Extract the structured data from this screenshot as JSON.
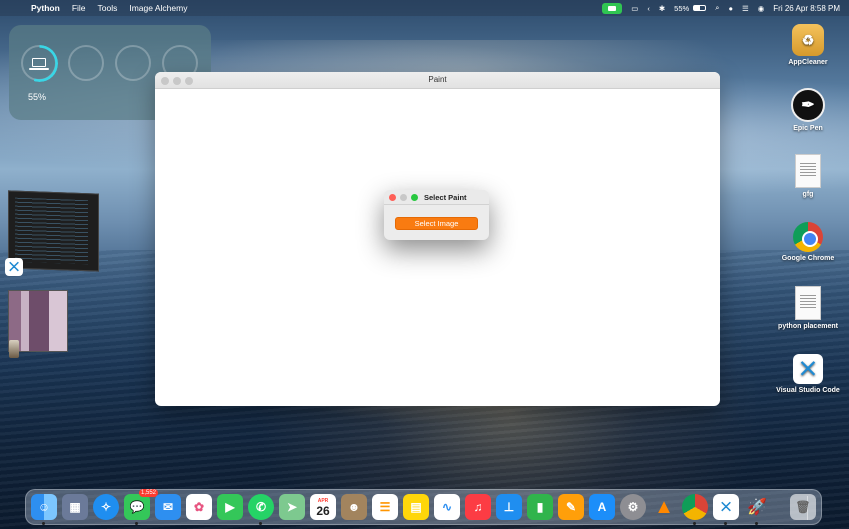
{
  "menubar": {
    "app_name": "Python",
    "menus": [
      "File",
      "Tools",
      "Image Alchemy"
    ],
    "battery_percent": "55%",
    "datetime": "Fri 26 Apr  8:58 PM"
  },
  "widget": {
    "battery_label": "55%",
    "battery_level": 0.55
  },
  "desktop_icons": [
    {
      "label": "AppCleaner",
      "icon": "appcleaner-icon"
    },
    {
      "label": "Epic Pen",
      "icon": "epic-pen-icon"
    },
    {
      "label": "gfg",
      "icon": "document-icon"
    },
    {
      "label": "Google Chrome",
      "icon": "chrome-icon"
    },
    {
      "label": "python placement",
      "icon": "document-icon"
    },
    {
      "label": "Visual Studio Code",
      "icon": "vscode-icon"
    }
  ],
  "window": {
    "title": "Paint"
  },
  "dialog": {
    "title": "Select Paint",
    "button_label": "Select Image"
  },
  "dock": {
    "messages_badge": "1,552",
    "calendar_month": "APR",
    "calendar_day": "26",
    "apps": [
      "Finder",
      "Launchpad",
      "Safari",
      "Messages",
      "Mail",
      "Photos",
      "FaceTime",
      "WhatsApp",
      "Maps",
      "Calendar",
      "Contacts",
      "Reminders",
      "Notes",
      "Freeform",
      "Music",
      "Keynote",
      "Numbers",
      "Pages",
      "App Store",
      "System Settings",
      "VLC",
      "Google Chrome",
      "Visual Studio Code",
      "Python",
      "Trash"
    ]
  },
  "colors": {
    "accent_orange": "#f97b11",
    "close_red": "#fe5f57",
    "minimize_gray": "#c8c8c8",
    "maximize_green": "#28c840"
  }
}
